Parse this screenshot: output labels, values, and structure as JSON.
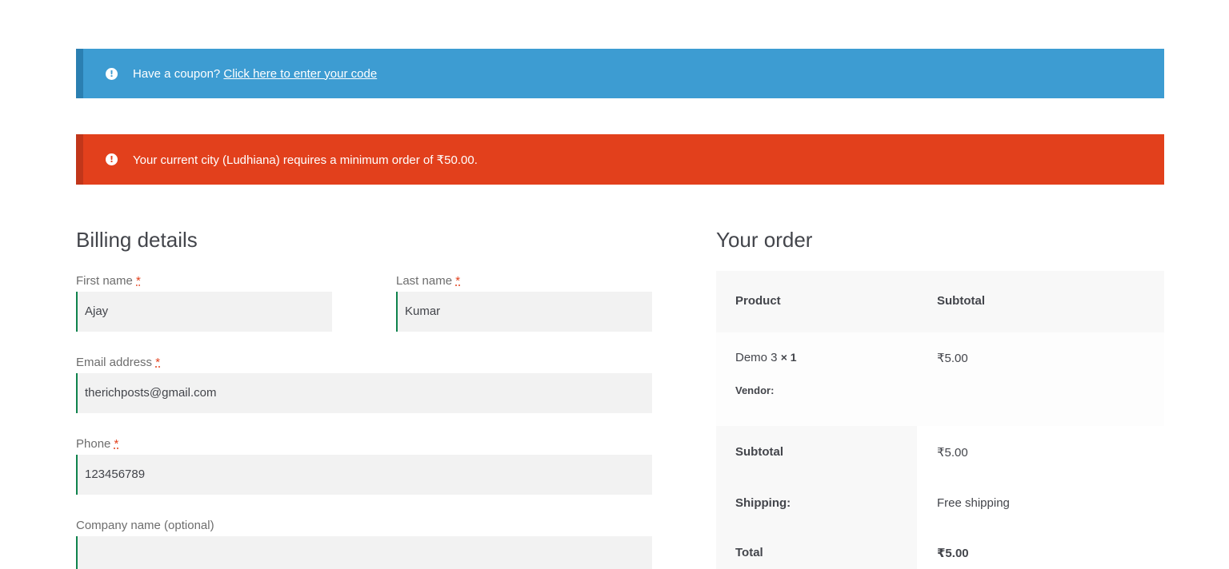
{
  "notices": {
    "coupon_text": "Have a coupon?",
    "coupon_link": "Click here to enter your code",
    "error_text": "Your current city (Ludhiana) requires a minimum order of ₹50.00.",
    "icon": "exclamation-circle-icon",
    "info_color": "#3d9cd2",
    "error_color": "#e2401c"
  },
  "billing": {
    "title": "Billing details",
    "required_mark": "*",
    "first_name": {
      "label": "First name",
      "value": "Ajay"
    },
    "last_name": {
      "label": "Last name",
      "value": "Kumar"
    },
    "email": {
      "label": "Email address",
      "value": "therichposts@gmail.com"
    },
    "phone": {
      "label": "Phone",
      "value": "123456789"
    },
    "company": {
      "label": "Company name (optional)",
      "value": ""
    }
  },
  "order": {
    "title": "Your order",
    "header": {
      "product": "Product",
      "subtotal": "Subtotal"
    },
    "item": {
      "name": "Demo 3",
      "qty": "× 1",
      "price": "₹5.00",
      "vendor_label": "Vendor:"
    },
    "subtotal": {
      "label": "Subtotal",
      "value": "₹5.00"
    },
    "shipping": {
      "label": "Shipping:",
      "value": "Free shipping"
    },
    "total": {
      "label": "Total",
      "value": "₹5.00"
    }
  }
}
